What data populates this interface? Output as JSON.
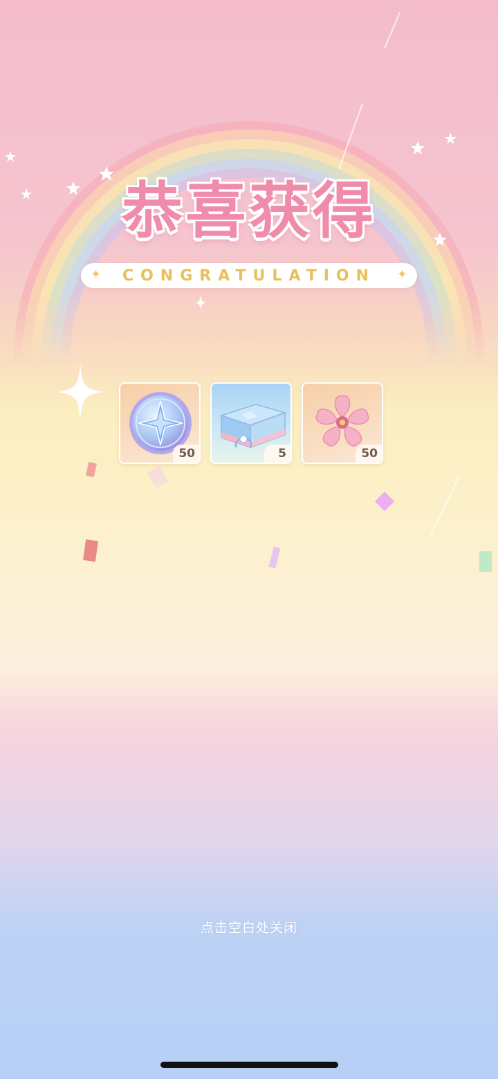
{
  "title": {
    "main": "恭喜获得",
    "subtitle": "CONGRATULATION"
  },
  "rewards": [
    {
      "icon": "star-compass-coin-icon",
      "quantity": "50"
    },
    {
      "icon": "gift-box-icon",
      "quantity": "5"
    },
    {
      "icon": "sakura-flower-icon",
      "quantity": "50"
    }
  ],
  "hint": "点击空白处关闭",
  "colors": {
    "title_pink": "#f08cab",
    "subtitle_gold": "#e7c05a",
    "quantity_text": "#6f5a4c"
  }
}
